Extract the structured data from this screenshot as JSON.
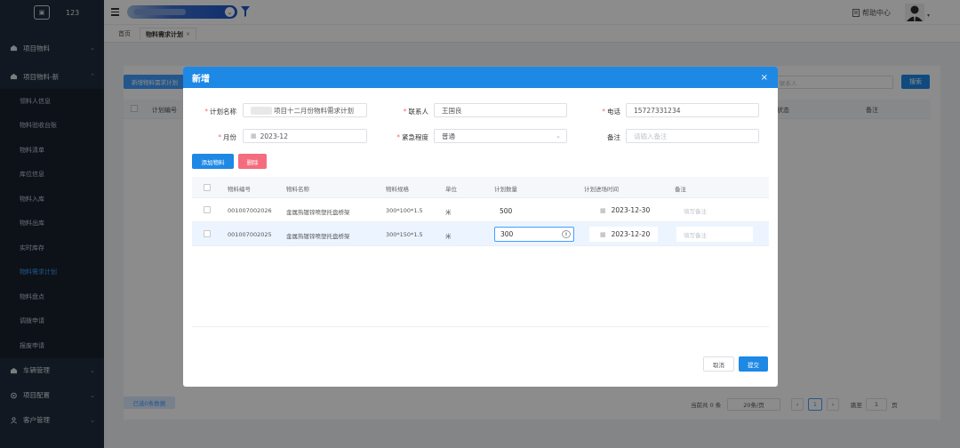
{
  "app": {
    "logo_text": "123"
  },
  "topbar": {
    "help_label": "帮助中心"
  },
  "tags": [
    {
      "label": "首页"
    },
    {
      "label": "物料需求计划"
    }
  ],
  "sidebar": {
    "groups": [
      {
        "label": "项目物料"
      },
      {
        "label": "项目物料-新"
      }
    ],
    "items": [
      {
        "label": "领料人信息"
      },
      {
        "label": "物料验收台账"
      },
      {
        "label": "物料清单"
      },
      {
        "label": "库位信息"
      },
      {
        "label": "物料入库"
      },
      {
        "label": "物料出库"
      },
      {
        "label": "实时库存"
      },
      {
        "label": "物料需求计划"
      },
      {
        "label": "物料盘点"
      },
      {
        "label": "调拨申请"
      },
      {
        "label": "报废申请"
      }
    ],
    "bottom_groups": [
      {
        "label": "车辆管理"
      },
      {
        "label": "项目配置"
      },
      {
        "label": "客户管理"
      }
    ]
  },
  "background": {
    "new_plan_button": "新增物料需求计划",
    "search_placeholder": "联系人",
    "search_button": "搜索",
    "columns": {
      "plan_no": "计划编号",
      "status": "状态",
      "remark": "备注"
    },
    "selected_label": "已选0条数据",
    "pager": {
      "total": "当前共 0 条",
      "page_size": "20条/页",
      "page": "1",
      "goto": "跳至",
      "goto_value": "1",
      "goto_suffix": "页",
      "prev": "‹",
      "next": "›"
    }
  },
  "dialog": {
    "title": "新增",
    "close": "×",
    "form": {
      "plan_name_label": "计划名称",
      "plan_name_value": "项目十二月份物料需求计划",
      "contact_label": "联系人",
      "contact_value": "王国良",
      "phone_label": "电话",
      "phone_value": "15727331234",
      "month_label": "月份",
      "month_value": "2023-12",
      "urgency_label": "紧急程度",
      "urgency_value": "普通",
      "remark_label": "备注",
      "remark_placeholder": "请输入备注"
    },
    "add_material_button": "添加物料",
    "delete_button": "删除",
    "table": {
      "headers": [
        "物料编号",
        "物料名称",
        "物料规格",
        "单位",
        "计划数量",
        "计划进场时间",
        "备注"
      ],
      "rows": [
        {
          "code": "001007002026",
          "name": "金属热镀锌喷塑托盘桥架",
          "spec": "300*100*1.5",
          "unit": "米",
          "qty": "500",
          "date": "2023-12-30",
          "remark_placeholder": "填写备注"
        },
        {
          "code": "001007002025",
          "name": "金属热镀锌喷塑托盘桥架",
          "spec": "300*150*1.5",
          "unit": "米",
          "qty": "300",
          "date": "2023-12-20",
          "remark_placeholder": "填写备注"
        }
      ]
    },
    "cancel_button": "取消",
    "submit_button": "提交"
  }
}
